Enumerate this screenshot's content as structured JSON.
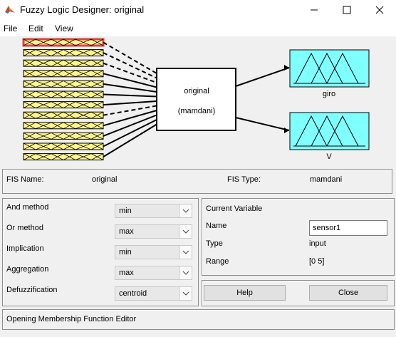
{
  "window": {
    "title": "Fuzzy Logic Designer: original"
  },
  "menu": [
    "File",
    "Edit",
    "View"
  ],
  "diagram": {
    "system_name": "original",
    "system_type": "(mamdani)",
    "outputs": [
      "giro",
      "V"
    ],
    "input_count": 12
  },
  "fis": {
    "name_label": "FIS Name:",
    "name_value": "original",
    "type_label": "FIS Type:",
    "type_value": "mamdani"
  },
  "methods": [
    {
      "label": "And method",
      "value": "min"
    },
    {
      "label": "Or method",
      "value": "max"
    },
    {
      "label": "Implication",
      "value": "min"
    },
    {
      "label": "Aggregation",
      "value": "max"
    },
    {
      "label": "Defuzzification",
      "value": "centroid"
    }
  ],
  "current_variable": {
    "title": "Current Variable",
    "name_label": "Name",
    "name_value": "sensor1",
    "type_label": "Type",
    "type_value": "input",
    "range_label": "Range",
    "range_value": "[0 5]"
  },
  "buttons": {
    "help": "Help",
    "close": "Close"
  },
  "status": "Opening Membership Function Editor",
  "colors": {
    "input_fill": "#fff58a",
    "output_fill": "#80ffff",
    "selected_border": "#e04040"
  }
}
